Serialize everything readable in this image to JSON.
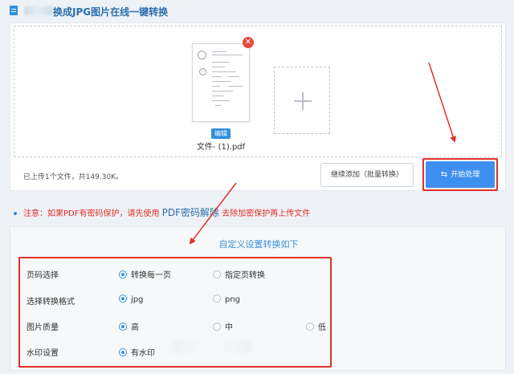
{
  "header": {
    "title": "换成JPG图片在线一键转换"
  },
  "upload": {
    "file_name": "文件- (1).pdf",
    "edit_label": "编辑",
    "remove_symbol": "✕",
    "status_text": "已上传1个文件，共149.30K。",
    "continue_label": "继续添加（批量转换）",
    "start_label": "开始处理",
    "start_icon": "swap-icon"
  },
  "notice": {
    "prefix": "注意：如果PDF有密码保护，请先使用",
    "link_text": "PDF密码解除",
    "suffix": "去除加密保护再上传文件"
  },
  "settings": {
    "title": "自定义设置转换如下",
    "rows": [
      {
        "label": "页码选择",
        "options": [
          "转换每一页",
          "指定页转换"
        ],
        "selected": "转换每一页"
      },
      {
        "label": "选择转换格式",
        "options": [
          "jpg",
          "png"
        ],
        "selected": "jpg"
      },
      {
        "label": "图片质量",
        "options": [
          "高",
          "中",
          "低"
        ],
        "selected": "高"
      },
      {
        "label": "水印设置",
        "options": [
          "有水印"
        ],
        "selected": "有水印"
      }
    ]
  },
  "colors": {
    "accent": "#3d8ff0",
    "highlight": "#e0302a",
    "title": "#2c6fad"
  }
}
